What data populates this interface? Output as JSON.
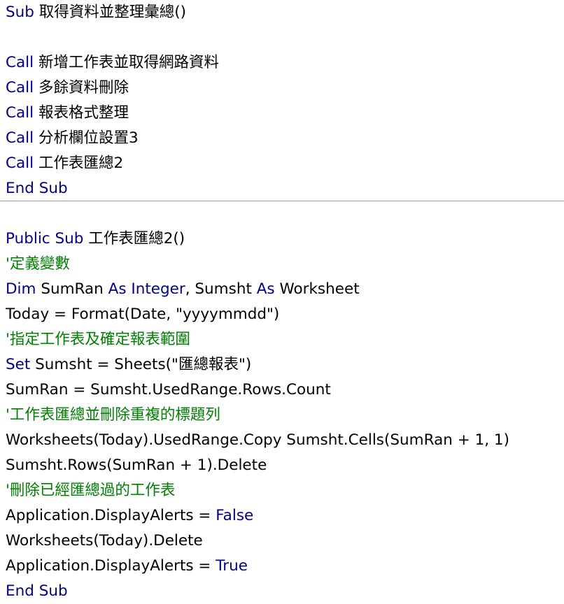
{
  "colors": {
    "keyword": "#00008b",
    "comment": "#008000",
    "text": "#000000",
    "divider": "#999999",
    "background": "#ffffff"
  },
  "procedures": [
    {
      "lines": [
        [
          {
            "t": "kw",
            "v": "Sub"
          },
          {
            "t": "tx",
            "v": " 取得資料並整理彙總()"
          }
        ],
        [],
        [
          {
            "t": "kw",
            "v": "Call"
          },
          {
            "t": "tx",
            "v": " 新增工作表並取得網路資料"
          }
        ],
        [
          {
            "t": "kw",
            "v": "Call"
          },
          {
            "t": "tx",
            "v": " 多餘資料刪除"
          }
        ],
        [
          {
            "t": "kw",
            "v": "Call"
          },
          {
            "t": "tx",
            "v": " 報表格式整理"
          }
        ],
        [
          {
            "t": "kw",
            "v": "Call"
          },
          {
            "t": "tx",
            "v": " 分析欄位設置3"
          }
        ],
        [
          {
            "t": "kw",
            "v": "Call"
          },
          {
            "t": "tx",
            "v": " 工作表匯總2"
          }
        ],
        [
          {
            "t": "kw",
            "v": "End Sub"
          }
        ]
      ]
    },
    {
      "lines": [
        [
          {
            "t": "kw",
            "v": "Public Sub"
          },
          {
            "t": "tx",
            "v": " 工作表匯總2()"
          }
        ],
        [
          {
            "t": "cm",
            "v": "'定義變數"
          }
        ],
        [
          {
            "t": "kw",
            "v": "Dim"
          },
          {
            "t": "tx",
            "v": " SumRan "
          },
          {
            "t": "kw",
            "v": "As Integer"
          },
          {
            "t": "tx",
            "v": ", Sumsht "
          },
          {
            "t": "kw",
            "v": "As"
          },
          {
            "t": "tx",
            "v": " Worksheet"
          }
        ],
        [
          {
            "t": "tx",
            "v": "Today = Format(Date, \"yyyymmdd\")"
          }
        ],
        [
          {
            "t": "cm",
            "v": "'指定工作表及確定報表範圍"
          }
        ],
        [
          {
            "t": "kw",
            "v": "Set"
          },
          {
            "t": "tx",
            "v": " Sumsht = Sheets(\"匯總報表\")"
          }
        ],
        [
          {
            "t": "tx",
            "v": "SumRan = Sumsht.UsedRange.Rows.Count"
          }
        ],
        [
          {
            "t": "cm",
            "v": "'工作表匯總並刪除重複的標題列"
          }
        ],
        [
          {
            "t": "tx",
            "v": "Worksheets(Today).UsedRange.Copy Sumsht.Cells(SumRan + 1, 1)"
          }
        ],
        [
          {
            "t": "tx",
            "v": "Sumsht.Rows(SumRan + 1).Delete"
          }
        ],
        [
          {
            "t": "cm",
            "v": "'刪除已經匯總過的工作表"
          }
        ],
        [
          {
            "t": "tx",
            "v": "Application.DisplayAlerts = "
          },
          {
            "t": "kw",
            "v": "False"
          }
        ],
        [
          {
            "t": "tx",
            "v": "Worksheets(Today).Delete"
          }
        ],
        [
          {
            "t": "tx",
            "v": "Application.DisplayAlerts = "
          },
          {
            "t": "kw",
            "v": "True"
          }
        ],
        [
          {
            "t": "kw",
            "v": "End Sub"
          }
        ]
      ]
    }
  ]
}
